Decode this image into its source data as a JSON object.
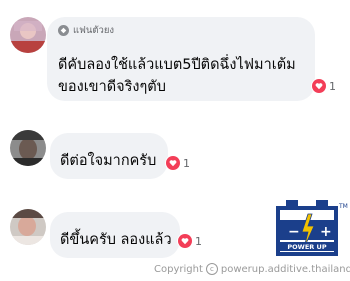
{
  "comments": [
    {
      "badge": "แฟนตัวยง",
      "text_line1": "ดีคับลองใช้แล้วแบต5ปีติดฉึ่งไฟมาเต้ม",
      "text_line2": "ของเขาดีจริงๆตับ",
      "reaction_count": "1"
    },
    {
      "text": "ดีต่อใจมากครับ",
      "reaction_count": "1"
    },
    {
      "text": "ดีขึ้นครับ ลองแล้ว",
      "reaction_count": "1"
    }
  ],
  "watermark": {
    "copyright_word": "Copyright",
    "copyright_symbol": "c",
    "source": "powerup.additive.thailand"
  },
  "logo": {
    "text": "POWER UP",
    "tm": "TM",
    "minus": "−",
    "plus": "+"
  },
  "colors": {
    "bubble": "#f0f2f5",
    "heart": "#f33e58",
    "logo_blue": "#1b3f8b",
    "logo_yellow": "#f2c200"
  }
}
